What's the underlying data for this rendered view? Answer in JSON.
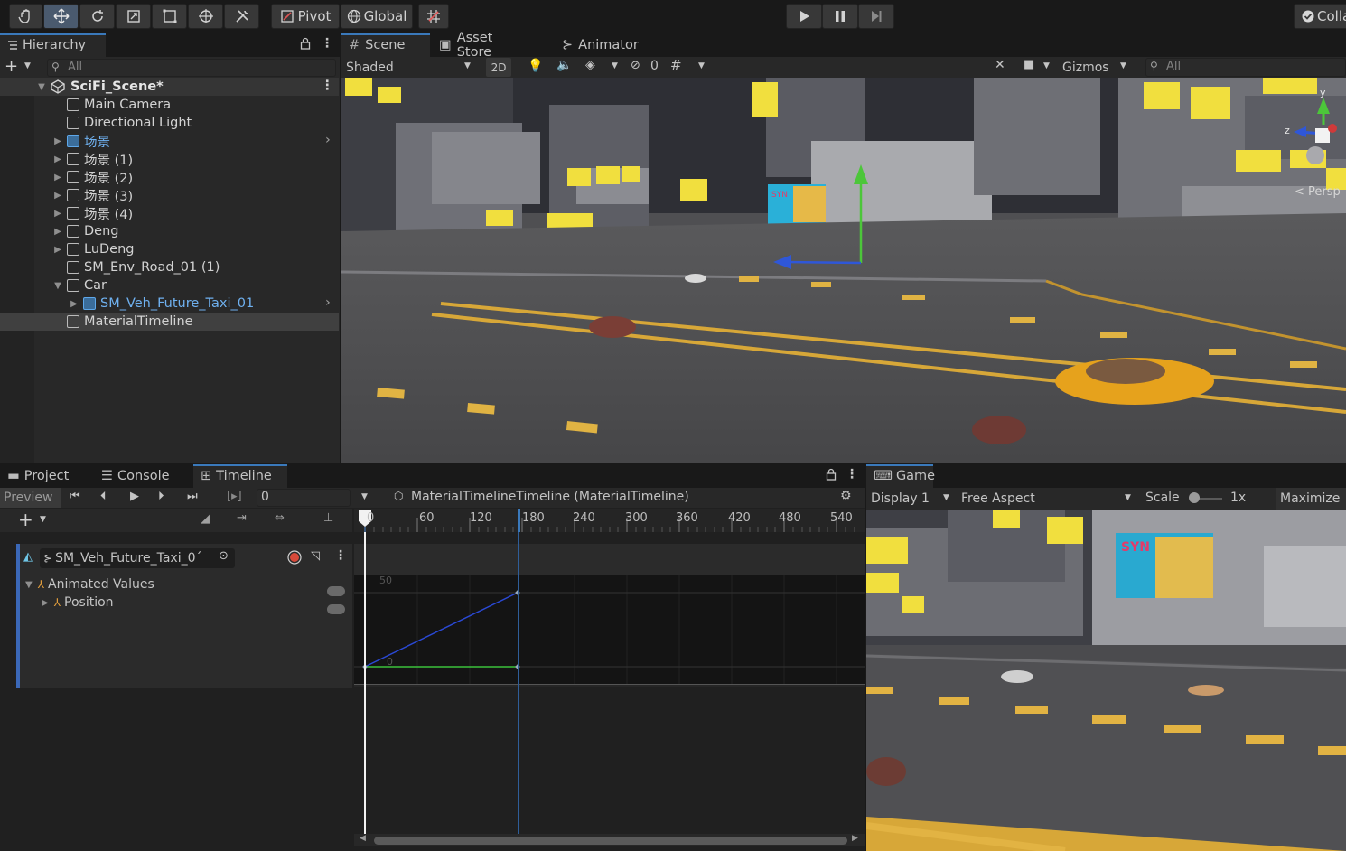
{
  "toolbar": {
    "tools": [
      "hand-tool",
      "move-tool",
      "rotate-tool",
      "scale-tool",
      "rect-tool",
      "transform-tool",
      "custom-tool"
    ],
    "pivot_label": "Pivot",
    "global_label": "Global",
    "collab_label": "Colla"
  },
  "hierarchy": {
    "tab_label": "Hierarchy",
    "search_placeholder": "All",
    "scene_name": "SciFi_Scene*",
    "items": [
      {
        "label": "Main Camera"
      },
      {
        "label": "Directional Light"
      },
      {
        "label": "场景"
      },
      {
        "label": "场景 (1)"
      },
      {
        "label": "场景 (2)"
      },
      {
        "label": "场景 (3)"
      },
      {
        "label": "场景 (4)"
      },
      {
        "label": "Deng"
      },
      {
        "label": "LuDeng"
      },
      {
        "label": "SM_Env_Road_01 (1)"
      },
      {
        "label": "Car"
      },
      {
        "label": "SM_Veh_Future_Taxi_01"
      },
      {
        "label": "MaterialTimeline"
      }
    ]
  },
  "scene_view": {
    "tabs": [
      "Scene",
      "Asset Store",
      "Animator"
    ],
    "shading_mode": "Shaded",
    "mode_2d": "2D",
    "hidden_count": "0",
    "gizmos_label": "Gizmos",
    "search_placeholder": "All",
    "persp_label": "< Persp",
    "gizmo_z": "z",
    "gizmo_y": "y",
    "billboard_text": "SYN"
  },
  "bottom_tabs": [
    "Project",
    "Console",
    "Timeline"
  ],
  "timeline": {
    "preview_label": "Preview",
    "frame_value": "0",
    "asset_label": "MaterialTimelineTimeline (MaterialTimeline)",
    "ruler_ticks": [
      "0",
      "60",
      "120",
      "180",
      "240",
      "300",
      "360",
      "420",
      "480",
      "540"
    ],
    "track_name": "SM_Veh_Future_Taxi_0´",
    "animated_values_label": "Animated Values",
    "position_label": "Position",
    "curve_top_label": "50",
    "curve_zero_label": "0"
  },
  "game_view": {
    "tab_label": "Game",
    "display_label": "Display 1",
    "aspect_label": "Free Aspect",
    "scale_label": "Scale",
    "scale_value": "1x",
    "maximize_label": "Maximize",
    "billboard_text": "SYN"
  }
}
